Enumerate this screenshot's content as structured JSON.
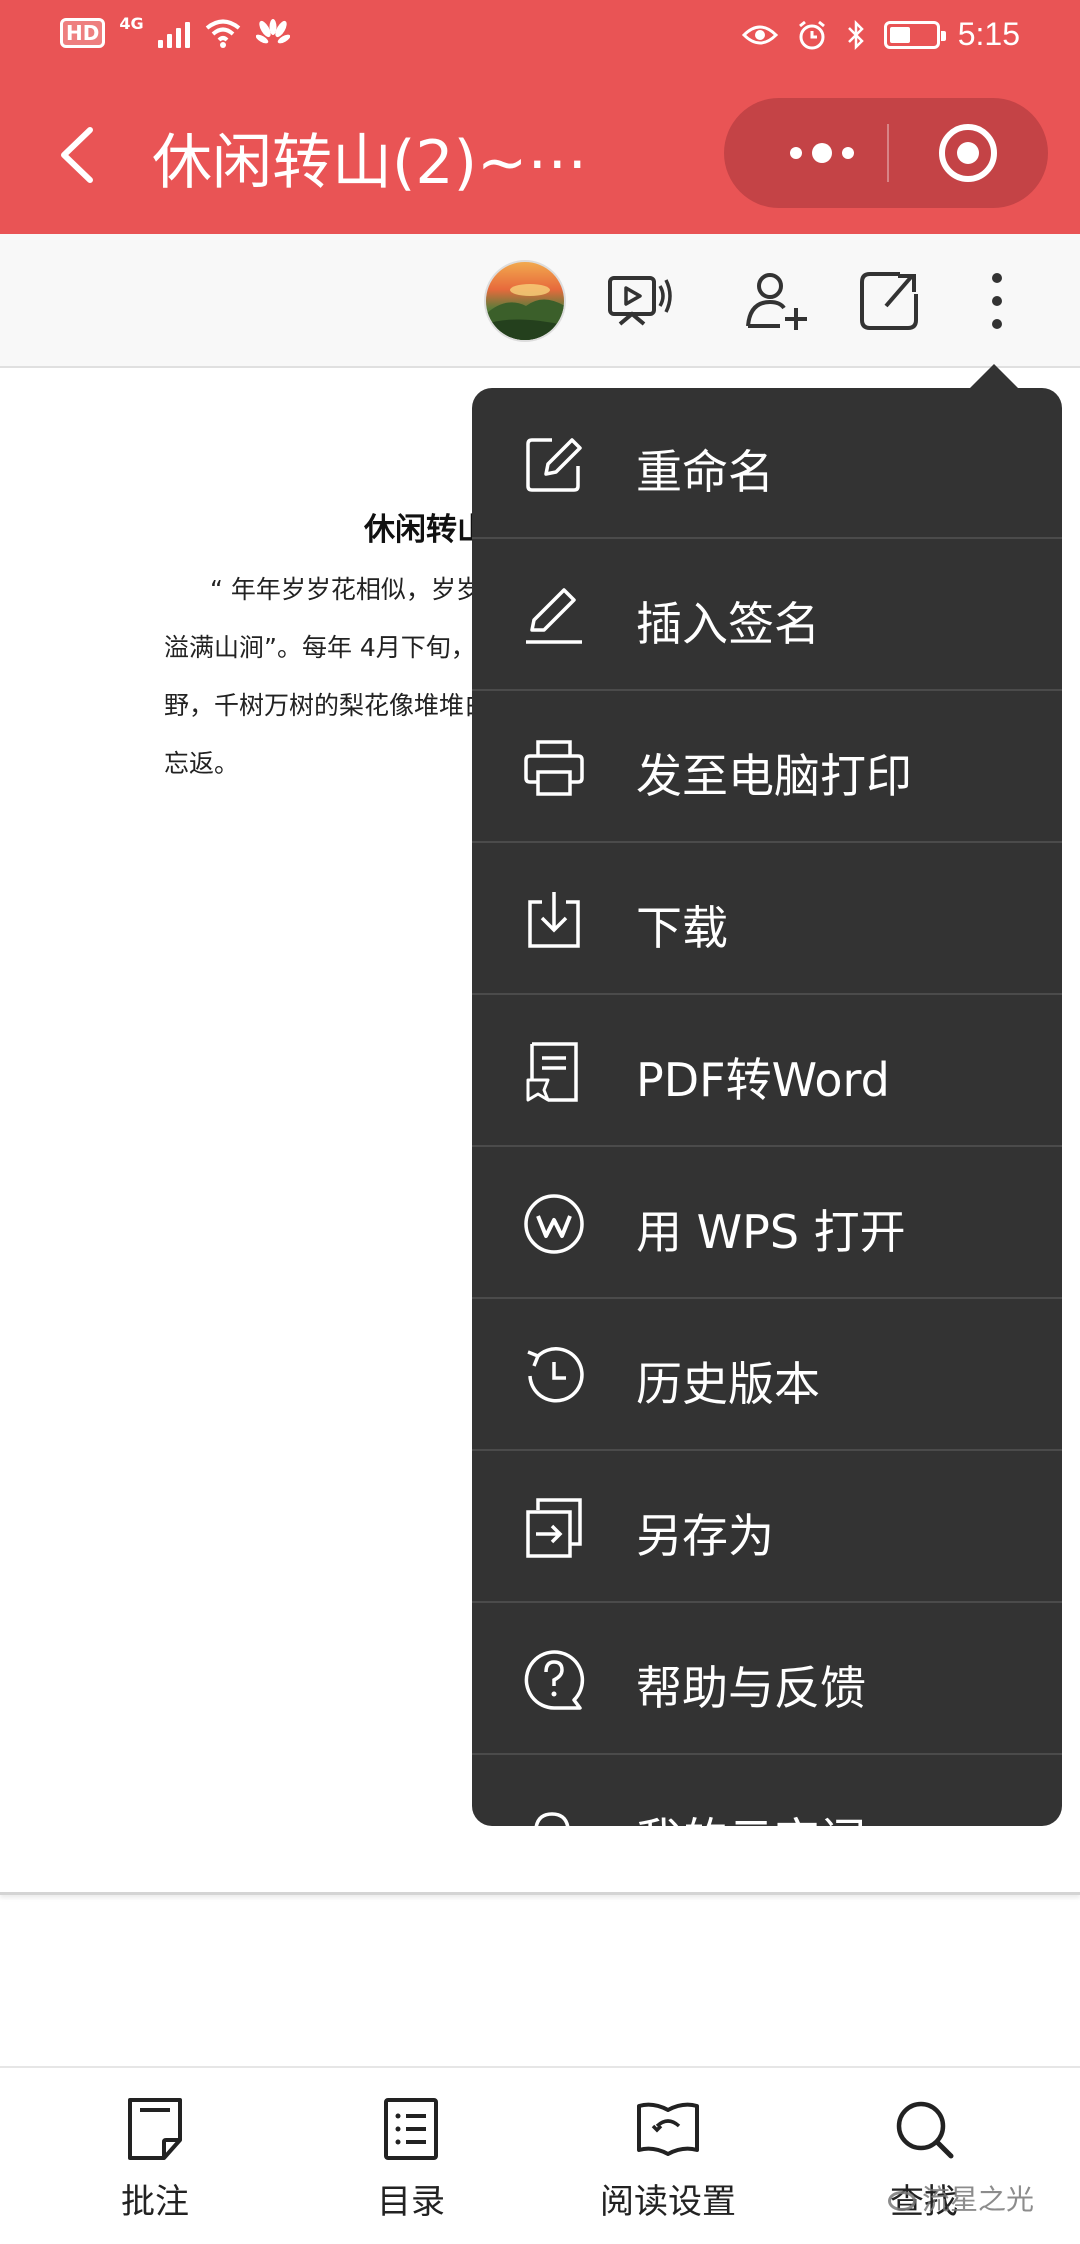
{
  "status_bar": {
    "hd_badge": "HD",
    "network": "4G",
    "time": "5:15",
    "battery_level": 0.45
  },
  "title_bar": {
    "title": "休闲转山(2)~⋯"
  },
  "document": {
    "title": "休闲转山",
    "lines": [
      "“ 年年岁岁花相似，岁岁",
      "溢满山涧”。每年 4月下旬，",
      "野，千树万树的梨花像堆堆白",
      "忘返。"
    ]
  },
  "menu": {
    "items": [
      {
        "label": "重命名",
        "icon": "edit-icon"
      },
      {
        "label": "插入签名",
        "icon": "pen-icon"
      },
      {
        "label": "发至电脑打印",
        "icon": "printer-icon"
      },
      {
        "label": "下载",
        "icon": "download-icon"
      },
      {
        "label": "PDF转Word",
        "icon": "pdf-to-word-icon"
      },
      {
        "label": "用 WPS 打开",
        "icon": "wps-icon"
      },
      {
        "label": "历史版本",
        "icon": "history-icon"
      },
      {
        "label": "另存为",
        "icon": "save-as-icon"
      },
      {
        "label": "帮助与反馈",
        "icon": "help-icon"
      },
      {
        "label": "我的云空间",
        "icon": "cloud-icon"
      }
    ]
  },
  "bottom_bar": {
    "items": [
      {
        "label": "批注",
        "icon": "annotation-icon"
      },
      {
        "label": "目录",
        "icon": "catalog-icon"
      },
      {
        "label": "阅读设置",
        "icon": "reading-settings-icon"
      },
      {
        "label": "查找",
        "icon": "search-icon"
      }
    ]
  },
  "watermark": "流星之光",
  "colors": {
    "header": "#e95455",
    "menu_bg": "#333333"
  }
}
